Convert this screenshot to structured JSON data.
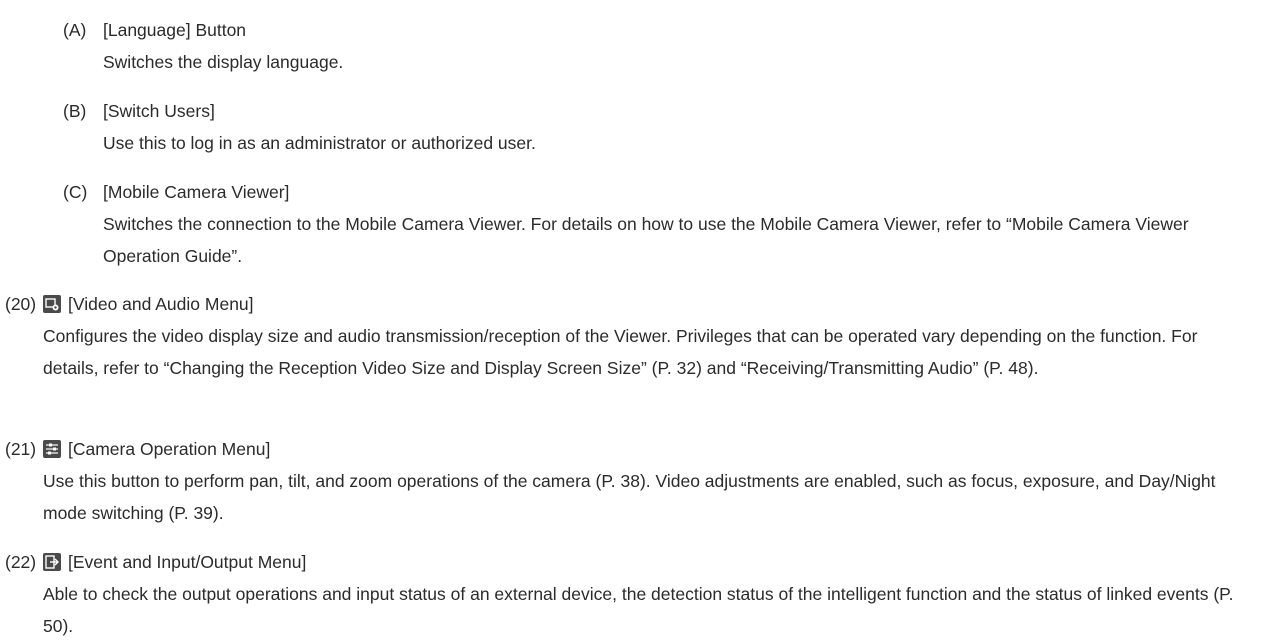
{
  "sub_items": [
    {
      "marker": "(A)",
      "title": "[Language] Button",
      "description": "Switches the display language."
    },
    {
      "marker": "(B)",
      "title": "[Switch Users]",
      "description": "Use this to log in as an administrator or authorized user."
    },
    {
      "marker": "(C)",
      "title": "[Mobile Camera Viewer]",
      "description": "Switches the connection to the Mobile Camera Viewer. For details on how to use the Mobile Camera Viewer, refer to “Mobile Camera Viewer Operation Guide”."
    }
  ],
  "main_items": [
    {
      "marker": "(20)",
      "icon": "video-audio-settings-icon",
      "title": "[Video and Audio Menu]",
      "description": "Configures the video display size and audio transmission/reception of the Viewer. Privileges that can be operated vary depending on the function. For details, refer to “Changing the Reception Video Size and Display Screen Size” (P. 32) and “Receiving/Transmitting Audio” (P. 48)."
    },
    {
      "marker": "(21)",
      "icon": "camera-operation-sliders-icon",
      "title": "[Camera Operation Menu]",
      "description": "Use this button to perform pan, tilt, and zoom operations of the camera (P. 38). Video adjustments are enabled, such as focus, exposure, and Day/Night mode switching (P. 39)."
    },
    {
      "marker": "(22)",
      "icon": "event-io-exit-icon",
      "title": "[Event and Input/Output Menu]",
      "description": "Able to check the output operations and input status of an external device, the detection status of the intelligent function and the status of linked events (P. 50)."
    }
  ]
}
